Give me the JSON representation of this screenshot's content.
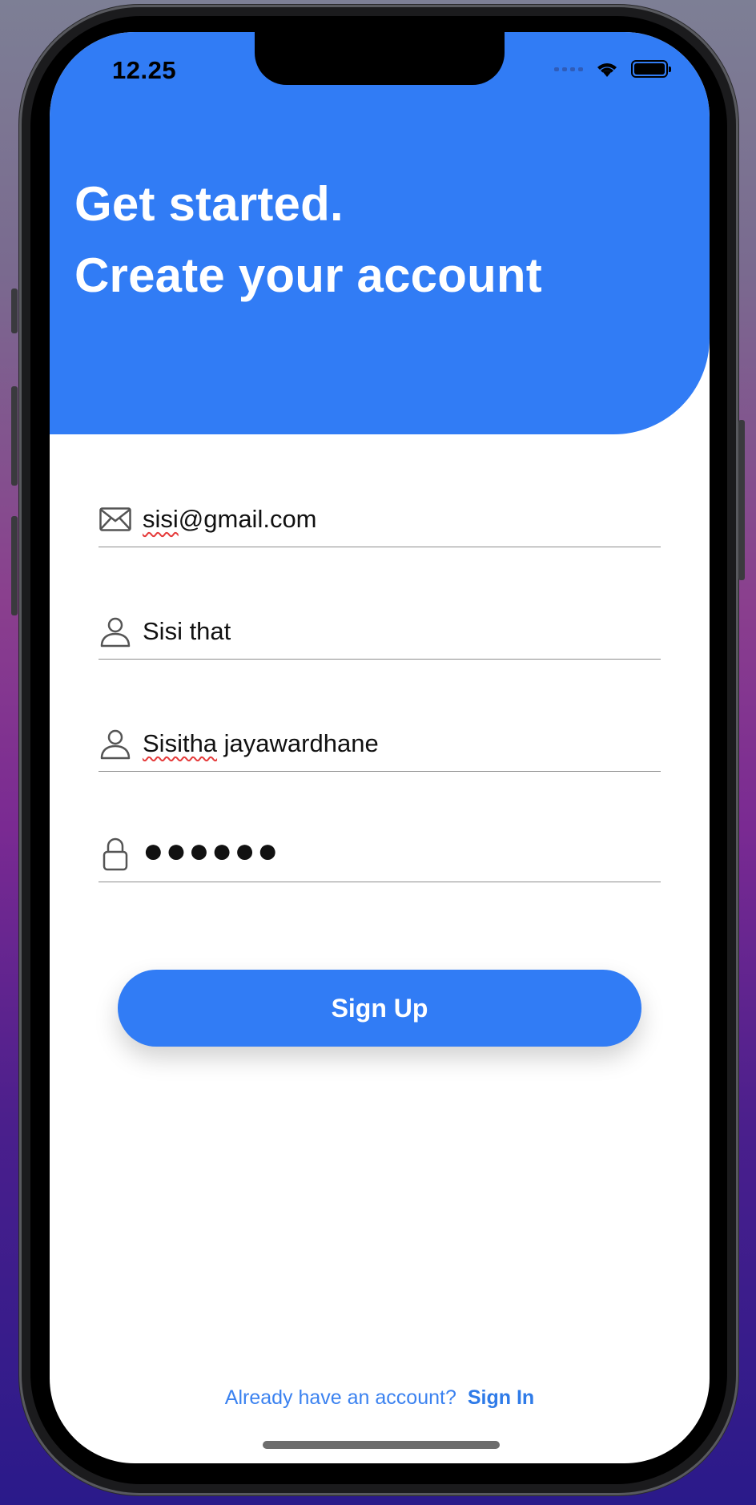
{
  "status_bar": {
    "time": "12.25"
  },
  "header": {
    "title_line_1": "Get started.",
    "title_line_2": "Create your account",
    "background_color": "#317cf5"
  },
  "form": {
    "email": {
      "icon": "mail-icon",
      "value": "sisi@gmail.com",
      "squiggle_part": "sisi",
      "rest": "@gmail.com"
    },
    "username": {
      "icon": "user-icon",
      "value": "Sisi that"
    },
    "full_name": {
      "icon": "user-icon",
      "value": "Sisitha jayawardhane",
      "squiggle_part": "Sisitha",
      "rest": " jayawardhane"
    },
    "password": {
      "icon": "lock-icon",
      "masked_value": "●●●●●●"
    }
  },
  "signup_button": {
    "label": "Sign Up"
  },
  "footer": {
    "question": "Already have an account?",
    "sign_in_label": "Sign In"
  },
  "accent_color": "#317cf5"
}
